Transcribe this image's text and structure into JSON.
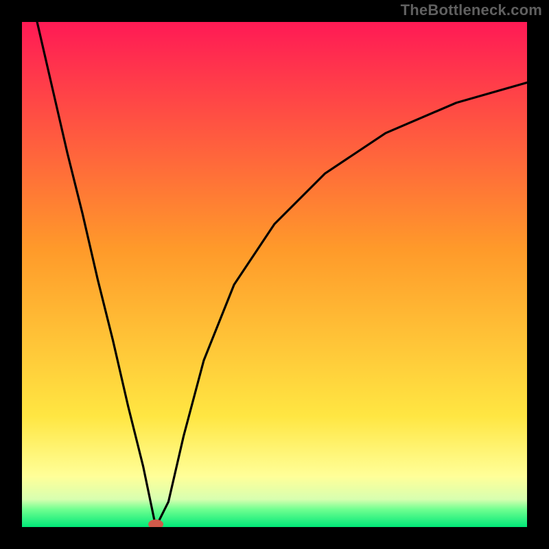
{
  "attribution": "TheBottleneck.com",
  "chart_data": {
    "type": "line",
    "title": "",
    "xlabel": "",
    "ylabel": "",
    "xlim": [
      0,
      100
    ],
    "ylim": [
      0,
      100
    ],
    "grid": false,
    "legend": false,
    "series": [
      {
        "name": "curve",
        "x": [
          3,
          6,
          9,
          12,
          15,
          18,
          21,
          24,
          26.5,
          29,
          32,
          36,
          42,
          50,
          60,
          72,
          86,
          100
        ],
        "values": [
          100,
          87,
          74,
          62,
          49,
          37,
          24,
          12,
          0,
          5,
          18,
          33,
          48,
          60,
          70,
          78,
          84,
          88
        ]
      }
    ],
    "markers": [
      {
        "name": "minimum",
        "x": 26.5,
        "y": 0,
        "color": "#d05a4a"
      }
    ],
    "background_gradient": [
      {
        "stop": 0.0,
        "color": "#ff1a55"
      },
      {
        "stop": 0.45,
        "color": "#ff9a2a"
      },
      {
        "stop": 0.78,
        "color": "#ffe642"
      },
      {
        "stop": 0.9,
        "color": "#ffff99"
      },
      {
        "stop": 0.945,
        "color": "#d8ffb0"
      },
      {
        "stop": 0.965,
        "color": "#70ff90"
      },
      {
        "stop": 1.0,
        "color": "#00e878"
      }
    ],
    "frame": {
      "color": "#000000",
      "thickness_px": 32
    }
  }
}
